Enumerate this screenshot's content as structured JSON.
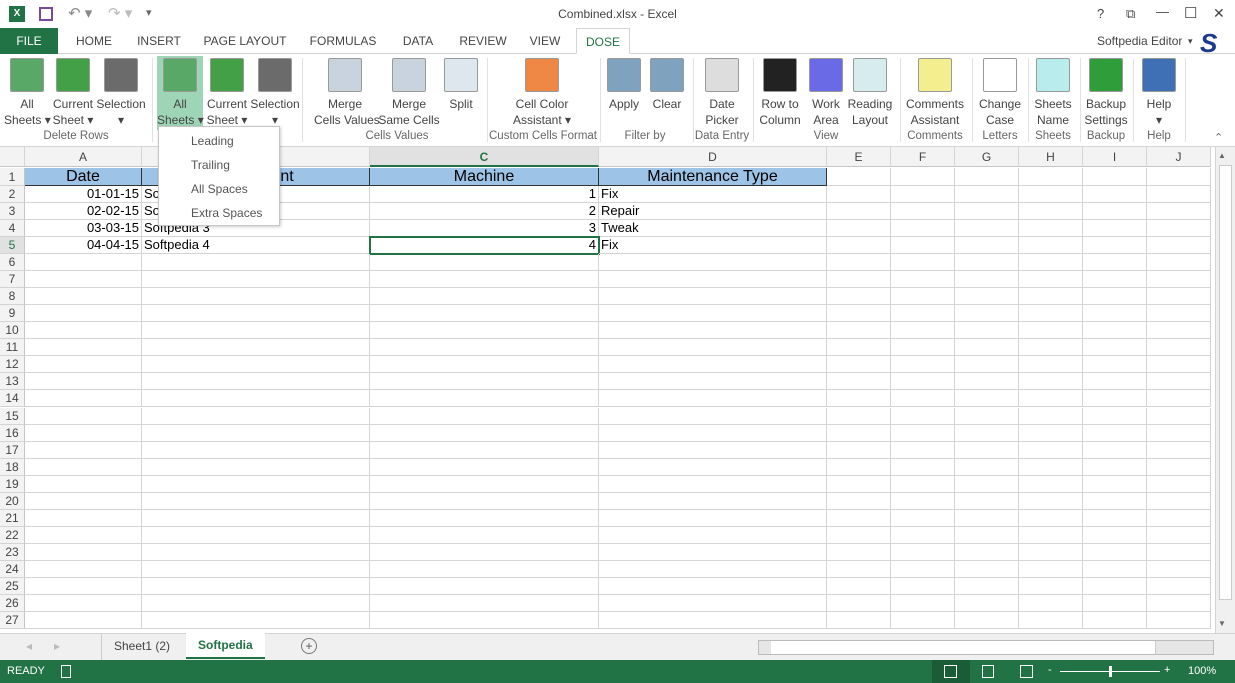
{
  "window": {
    "title": "Combined.xlsx - Excel",
    "controls": [
      "?",
      "⧉",
      "—",
      "☐",
      "✕"
    ]
  },
  "account": {
    "name": "Softpedia Editor",
    "logo": "S"
  },
  "tabs": [
    {
      "label": "FILE"
    },
    {
      "label": "HOME"
    },
    {
      "label": "INSERT"
    },
    {
      "label": "PAGE LAYOUT"
    },
    {
      "label": "FORMULAS"
    },
    {
      "label": "DATA"
    },
    {
      "label": "REVIEW"
    },
    {
      "label": "VIEW"
    },
    {
      "label": "DOSE",
      "active": true
    }
  ],
  "ribbon": {
    "buttons": [
      {
        "l1": "All",
        "l2": "Sheets ▾",
        "icon": "all-sheets-icon",
        "color": "#5aa867"
      },
      {
        "l1": "Current",
        "l2": "Sheet ▾",
        "icon": "current-sheet-icon",
        "color": "#43a047"
      },
      {
        "l1": "Selection",
        "l2": "▾",
        "icon": "selection-icon",
        "color": "#6b6b6b"
      },
      {
        "l1": "All",
        "l2": "Sheets ▾",
        "icon": "all-sheets-icon",
        "color": "#5aa867",
        "active": true
      },
      {
        "l1": "Current",
        "l2": "Sheet ▾",
        "icon": "current-sheet-icon",
        "color": "#43a047"
      },
      {
        "l1": "Selection",
        "l2": "▾",
        "icon": "selection-icon",
        "color": "#6b6b6b"
      },
      {
        "l1": "Merge",
        "l2": "Cells Values",
        "icon": "merge-cells-values-icon",
        "color": "#c9d3dd"
      },
      {
        "l1": "Merge",
        "l2": "Same Cells",
        "icon": "merge-same-cells-icon",
        "color": "#c9d3dd"
      },
      {
        "l1": "Split",
        "l2": "",
        "icon": "split-icon",
        "color": "#dfe7ee"
      },
      {
        "l1": "Cell Color",
        "l2": "Assistant ▾",
        "icon": "color-wheel-icon",
        "color": "#e84"
      },
      {
        "l1": "Apply",
        "l2": "",
        "icon": "filter-apply-icon",
        "color": "#7fa3bf"
      },
      {
        "l1": "Clear",
        "l2": "",
        "icon": "filter-clear-icon",
        "color": "#7fa3bf"
      },
      {
        "l1": "Date",
        "l2": "Picker",
        "icon": "calendar-icon",
        "color": "#ddd"
      },
      {
        "l1": "Row to",
        "l2": "Column",
        "icon": "row-to-column-icon",
        "color": "#222"
      },
      {
        "l1": "Work",
        "l2": "Area",
        "icon": "work-area-icon",
        "color": "#6a6ae6"
      },
      {
        "l1": "Reading",
        "l2": "Layout",
        "icon": "reading-layout-icon",
        "color": "#d7ecec"
      },
      {
        "l1": "Comments",
        "l2": "Assistant",
        "icon": "comments-icon",
        "color": "#f4ef8e"
      },
      {
        "l1": "Change",
        "l2": "Case",
        "icon": "change-case-icon",
        "color": "#fff"
      },
      {
        "l1": "Sheets",
        "l2": "Name",
        "icon": "sheets-name-icon",
        "color": "#b9ecec"
      },
      {
        "l1": "Backup",
        "l2": "Settings",
        "icon": "backup-icon",
        "color": "#2e9d3a"
      },
      {
        "l1": "Help",
        "l2": "▾",
        "icon": "help-icon",
        "color": "#3f6fb5"
      }
    ],
    "groups": [
      "Delete Rows",
      "Cells Values",
      "Custom Cells Format",
      "Filter by",
      "Data Entry",
      "View",
      "Comments",
      "Letters",
      "Sheets",
      "Backup",
      "Help"
    ]
  },
  "dropdown": {
    "items": [
      "Leading",
      "Trailing",
      "All Spaces",
      "Extra Spaces"
    ]
  },
  "sheet": {
    "columns": [
      "A",
      "B",
      "C",
      "D",
      "E",
      "F",
      "G",
      "H",
      "I",
      "J"
    ],
    "selected_column": "C",
    "selected_row": 5,
    "row_count": 27,
    "header": [
      "Date",
      "Equipment",
      "Machine",
      "Maintenance Type"
    ],
    "rows": [
      [
        "01-01-15",
        "Softpedia 1",
        "1",
        "Fix"
      ],
      [
        "02-02-15",
        "Softpedia 2",
        "2",
        "Repair"
      ],
      [
        "03-03-15",
        "Softpedia 3",
        "3",
        "Tweak"
      ],
      [
        "04-04-15",
        "Softpedia 4",
        "4",
        "Fix"
      ]
    ],
    "header_color": "#9dc3e6"
  },
  "sheet_tabs": [
    {
      "label": "Sheet1 (2)"
    },
    {
      "label": "Softpedia",
      "active": true
    }
  ],
  "status": {
    "text": "READY",
    "zoom": "100%"
  }
}
